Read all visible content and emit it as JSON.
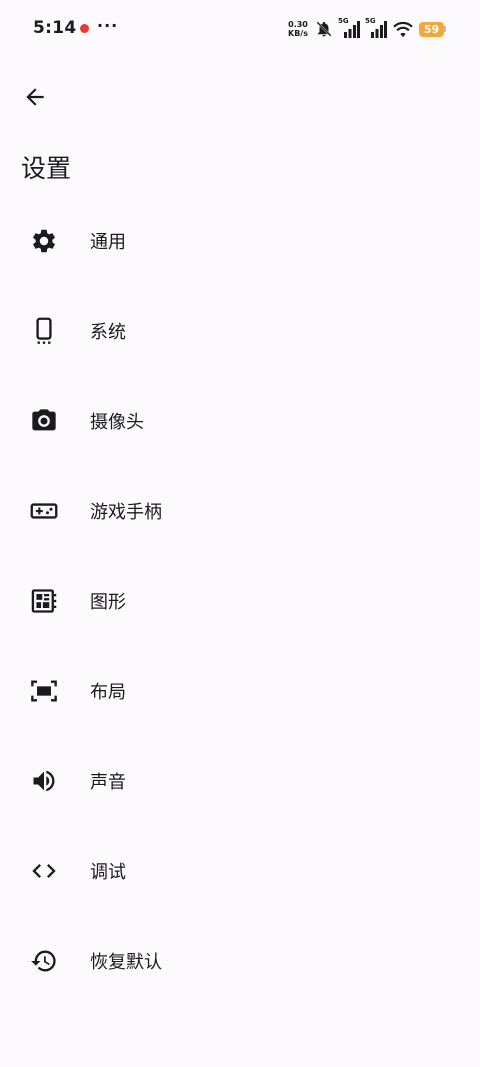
{
  "status_bar": {
    "time": "5:14",
    "more": "···",
    "speed_value": "0.30",
    "speed_unit": "KB/s",
    "sim1_label": "5G",
    "sim2_label": "5G",
    "battery": "59",
    "battery_color": "#f2a83b",
    "notification_color": "#e5393c"
  },
  "header": {
    "back_icon": "arrow-back-icon",
    "title": "设置"
  },
  "menu": {
    "items": [
      {
        "label": "通用",
        "icon": "gear-icon"
      },
      {
        "label": "系统",
        "icon": "phone-icon"
      },
      {
        "label": "摄像头",
        "icon": "camera-icon"
      },
      {
        "label": "游戏手柄",
        "icon": "gamepad-icon"
      },
      {
        "label": "图形",
        "icon": "graphics-chip-icon"
      },
      {
        "label": "布局",
        "icon": "layout-frame-icon"
      },
      {
        "label": "声音",
        "icon": "speaker-icon"
      },
      {
        "label": "调试",
        "icon": "code-icon"
      },
      {
        "label": "恢复默认",
        "icon": "restore-history-icon"
      }
    ]
  }
}
